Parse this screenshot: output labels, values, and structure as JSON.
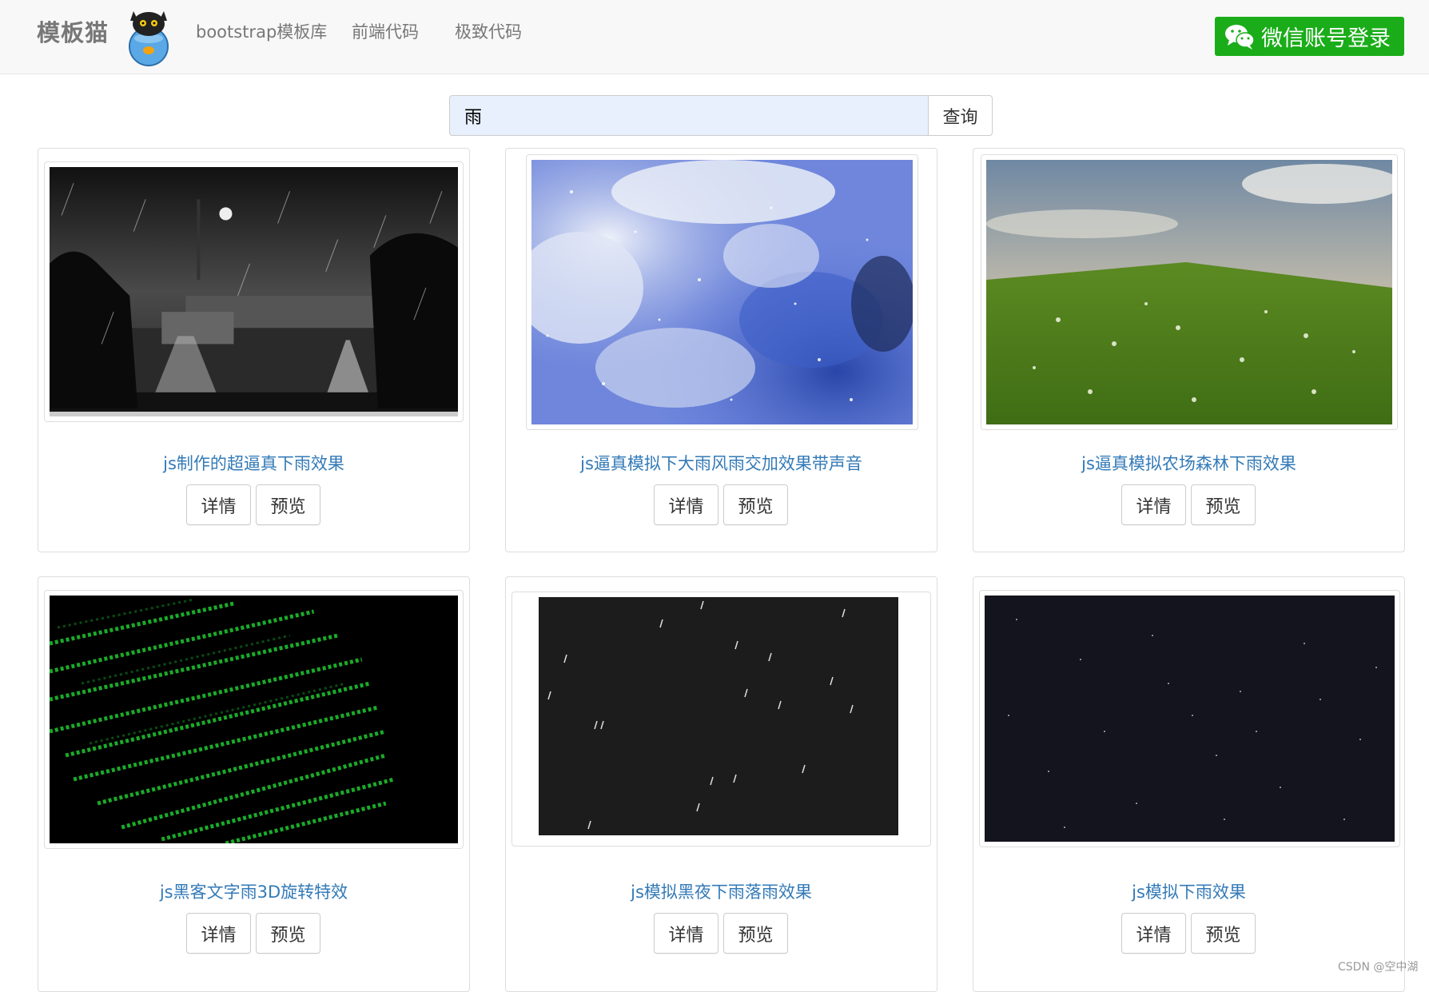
{
  "header": {
    "brand": "模板猫",
    "nav": [
      "bootstrap模板库",
      "前端代码",
      "极致代码"
    ],
    "login_button": "微信账号登录"
  },
  "search": {
    "value": "雨",
    "button": "查询"
  },
  "cards": [
    {
      "title": "js制作的超逼真下雨效果",
      "detail": "详情",
      "preview": "预览"
    },
    {
      "title": "js逼真模拟下大雨风雨交加效果带声音",
      "detail": "详情",
      "preview": "预览"
    },
    {
      "title": "js逼真模拟农场森林下雨效果",
      "detail": "详情",
      "preview": "预览"
    },
    {
      "title": "js黑客文字雨3D旋转特效",
      "detail": "详情",
      "preview": "预览"
    },
    {
      "title": "js模拟黑夜下雨落雨效果",
      "detail": "详情",
      "preview": "预览"
    },
    {
      "title": "js模拟下雨效果",
      "detail": "详情",
      "preview": "预览"
    }
  ],
  "watermark": "CSDN @空中湖",
  "colors": {
    "link": "#337ab7",
    "wechat_green": "#1aad19",
    "navbar_bg": "#f8f8f8"
  }
}
